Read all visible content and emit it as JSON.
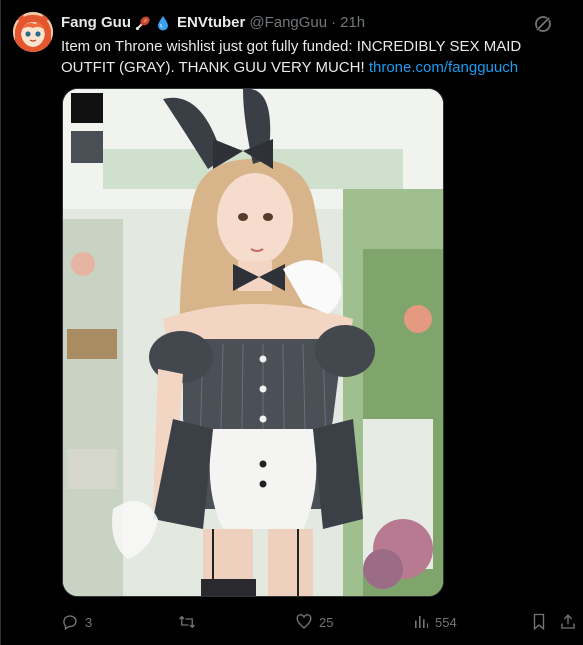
{
  "tweet": {
    "display_name": "Fang Guu",
    "display_name_2": "ENVtuber",
    "handle": "@FangGuu",
    "separator": "·",
    "time": "21h",
    "text_main": "Item on Throne wishlist just got fully funded: INCREDIBLY SEX MAID OUTFIT (GRAY). THANK GUU VERY MUCH! ",
    "text_link": "throne.com/fangguuch",
    "emojis": [
      "meat-icon",
      "droplet-icon"
    ]
  },
  "actions": {
    "reply_count": "3",
    "retweet_count": "",
    "like_count": "25",
    "view_count": "554"
  },
  "colors": {
    "background": "#000000",
    "text": "#e7e9ea",
    "muted": "#71767b",
    "link": "#1d9bf0",
    "border": "#2f3336"
  }
}
